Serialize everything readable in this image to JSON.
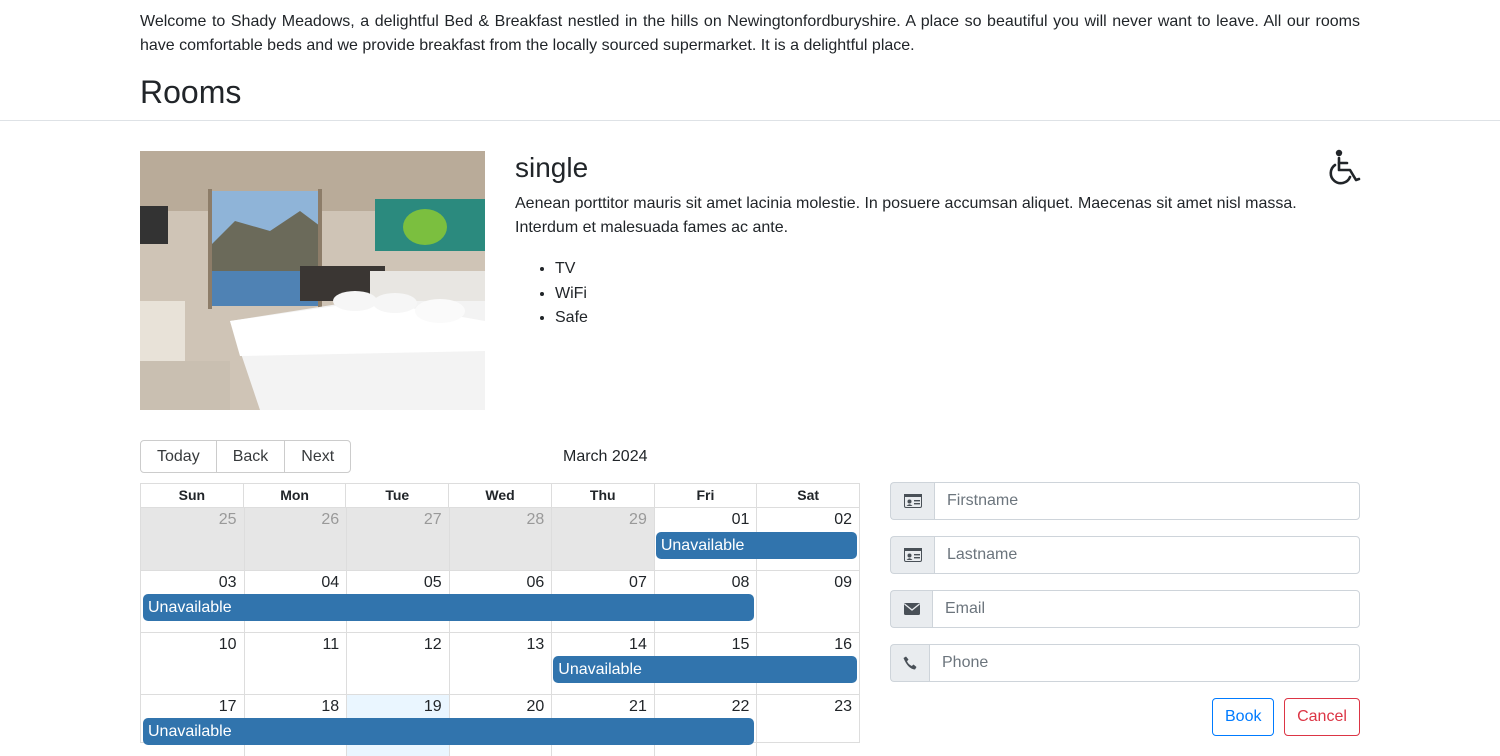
{
  "intro": {
    "text": "Welcome to Shady Meadows, a delightful Bed & Breakfast nestled in the hills on Newingtonfordburyshire. A place so beautiful you will never want to leave. All our rooms have comfortable beds and we provide breakfast from the locally sourced supermarket. It is a delightful place."
  },
  "rooms": {
    "title": "Rooms"
  },
  "room": {
    "type": "single",
    "description": "Aenean porttitor mauris sit amet lacinia molestie. In posuere accumsan aliquet. Maecenas sit amet nisl massa. Interdum et malesuada fames ac ante.",
    "features": [
      "TV",
      "WiFi",
      "Safe"
    ],
    "accessibility_icon": "wheelchair-icon"
  },
  "calendar": {
    "toolbar": {
      "today": "Today",
      "back": "Back",
      "next": "Next"
    },
    "label": "March 2024",
    "weekdays": [
      "Sun",
      "Mon",
      "Tue",
      "Wed",
      "Thu",
      "Fri",
      "Sat"
    ],
    "weeks": [
      [
        "25",
        "26",
        "27",
        "28",
        "29",
        "01",
        "02"
      ],
      [
        "03",
        "04",
        "05",
        "06",
        "07",
        "08",
        "09"
      ],
      [
        "10",
        "11",
        "12",
        "13",
        "14",
        "15",
        "16"
      ],
      [
        "17",
        "18",
        "19",
        "20",
        "21",
        "22",
        "23"
      ]
    ],
    "off_range_days": [
      "25",
      "26",
      "27",
      "28",
      "29"
    ],
    "today": "19",
    "events": [
      {
        "week": 0,
        "start": 5,
        "end": 6,
        "title": "Unavailable"
      },
      {
        "week": 1,
        "start": 0,
        "end": 5,
        "title": "Unavailable"
      },
      {
        "week": 2,
        "start": 4,
        "end": 6,
        "title": "Unavailable"
      },
      {
        "week": 3,
        "start": 0,
        "end": 5,
        "title": "Unavailable"
      }
    ],
    "event_color": "#3174ad"
  },
  "booking_form": {
    "firstname_placeholder": "Firstname",
    "lastname_placeholder": "Lastname",
    "email_placeholder": "Email",
    "phone_placeholder": "Phone",
    "book_label": "Book",
    "cancel_label": "Cancel",
    "book_color": "#007bff",
    "cancel_color": "#dc3545"
  }
}
